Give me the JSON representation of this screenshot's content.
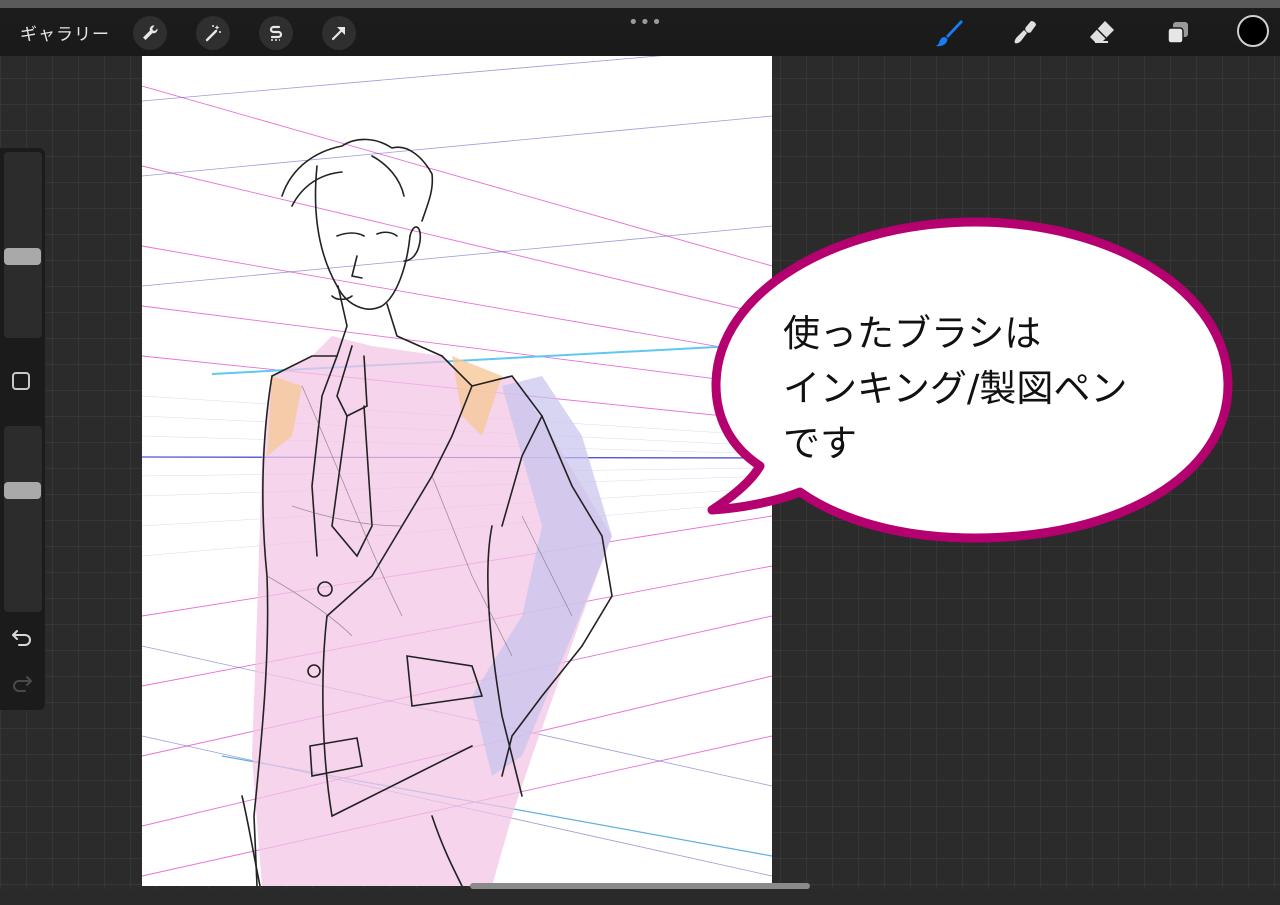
{
  "toolbar": {
    "gallery_label": "ギャラリー",
    "left_tools": [
      "wrench-icon",
      "magic-wand-icon",
      "selection-icon",
      "transform-arrow-icon"
    ],
    "right_tools": [
      "brush-icon",
      "smudge-icon",
      "eraser-icon",
      "layers-icon"
    ],
    "more_label": "•••",
    "active_tool_color": "#1a7cf5",
    "current_color": "#000000"
  },
  "sidebar": {
    "size_slider_value": 0.32,
    "opacity_slider_value": 0.4,
    "icons": [
      "modifier-square-icon",
      "undo-icon",
      "redo-icon"
    ]
  },
  "callout": {
    "lines": [
      "使ったブラシは",
      "インキング/製図ペン",
      "です"
    ],
    "border_color": "#b5006f"
  }
}
